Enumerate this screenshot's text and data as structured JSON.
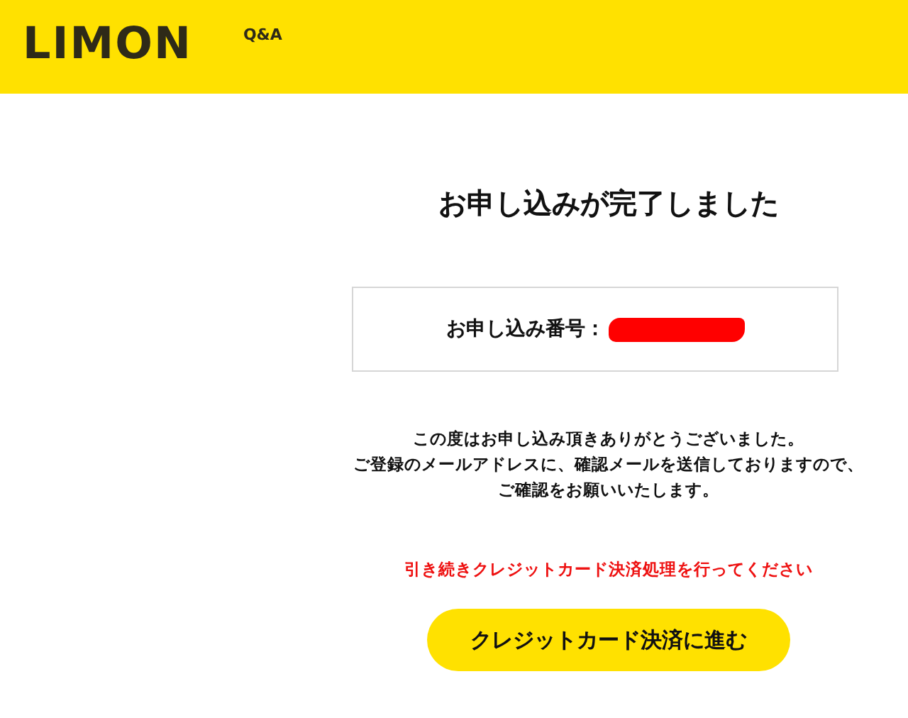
{
  "header": {
    "logo": "LIMON",
    "nav": [
      "Q&A"
    ]
  },
  "title": "お申し込みが完了しました",
  "application_number": {
    "label": "お申し込み番号：",
    "value_redacted": true
  },
  "message": [
    "この度はお申し込み頂きありがとうございました。",
    "ご登録のメールアドレスに、確認メールを送信しておりますので、",
    "ご確認をお願いいたします。"
  ],
  "notice": "引き続きクレジットカード決済処理を行ってください",
  "button": "クレジットカード決済に進む"
}
